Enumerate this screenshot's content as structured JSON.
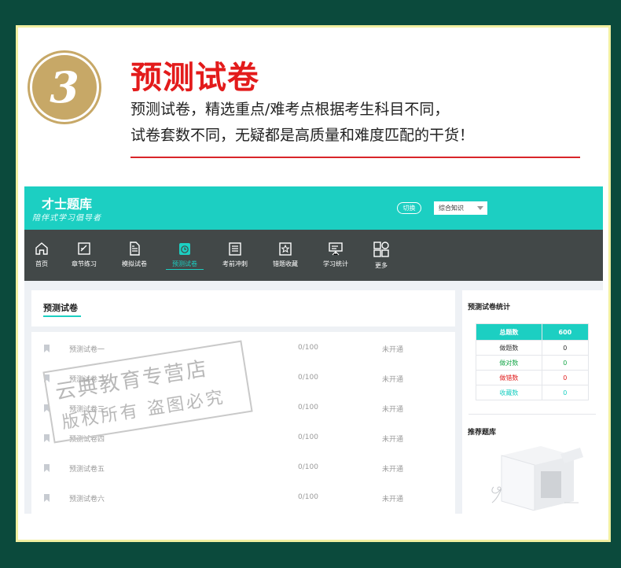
{
  "step": {
    "number": "3"
  },
  "hero": {
    "title": "预测试卷",
    "desc_line1": "预测试卷，精选重点/难考点根据考生科目不同，",
    "desc_line2": "试卷套数不同，无疑都是高质量和难度匹配的干货！"
  },
  "app": {
    "brand": "才士题库",
    "tagline": "陪伴式学习倡导者",
    "switch_label": "切换",
    "subject_select": "综合知识",
    "nav": [
      {
        "label": "首页",
        "icon": "home-icon"
      },
      {
        "label": "章节练习",
        "icon": "edit-icon"
      },
      {
        "label": "模拟试卷",
        "icon": "document-icon"
      },
      {
        "label": "预测试卷",
        "icon": "clock-icon",
        "active": true
      },
      {
        "label": "考前冲刺",
        "icon": "list-icon"
      },
      {
        "label": "错题收藏",
        "icon": "star-icon"
      },
      {
        "label": "学习统计",
        "icon": "presentation-icon"
      },
      {
        "label": "更多",
        "icon": "grid-icon"
      }
    ],
    "section_title": "预测试卷",
    "papers": [
      {
        "name": "预测试卷一",
        "score": "0/100",
        "status": "未开通"
      },
      {
        "name": "预测试卷二",
        "score": "0/100",
        "status": "未开通"
      },
      {
        "name": "预测试卷三",
        "score": "0/100",
        "status": "未开通"
      },
      {
        "name": "预测试卷四",
        "score": "0/100",
        "status": "未开通"
      },
      {
        "name": "预测试卷五",
        "score": "0/100",
        "status": "未开通"
      },
      {
        "name": "预测试卷六",
        "score": "0/100",
        "status": "未开通"
      }
    ],
    "stats_title": "预测试卷统计",
    "stats": {
      "total_label": "总题数",
      "total_value": "600",
      "done_label": "做题数",
      "done_value": "0",
      "right_label": "做对数",
      "right_value": "0",
      "wrong_label": "做错数",
      "wrong_value": "0",
      "fav_label": "收藏数",
      "fav_value": "0"
    },
    "recommend_title": "推荐题库"
  },
  "watermark": {
    "line1": "云典教育专营店",
    "line2": "版权所有 盗图必究"
  },
  "colors": {
    "teal": "#1ccfc2",
    "nav_bg": "#424848",
    "title_red": "#e31b1b",
    "gold": "#c7a867",
    "correct": "#1aa84c",
    "wrong": "#e02020"
  }
}
